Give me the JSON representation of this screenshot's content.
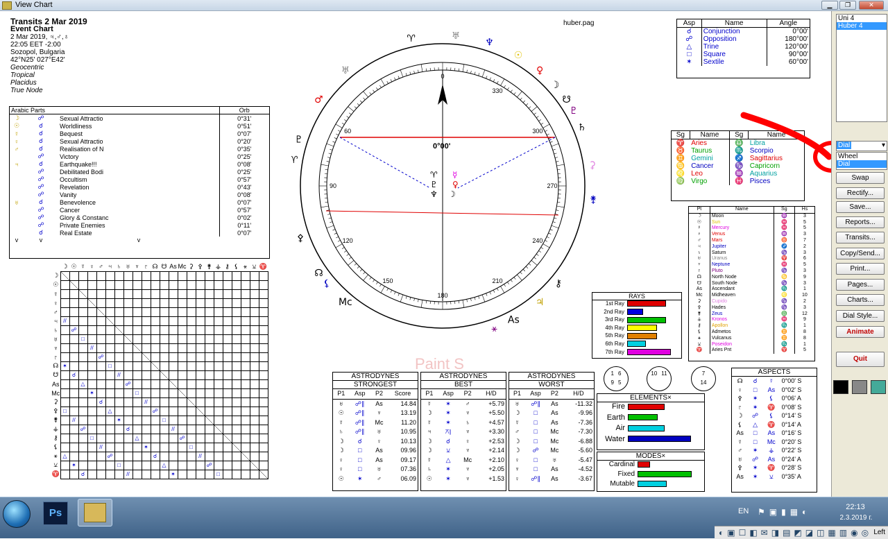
{
  "window": {
    "title": "View Chart"
  },
  "header": {
    "title": "Transits 2 Mar 2019",
    "subtitle": "Event Chart",
    "lines": [
      "2 Mar 2019, ♃,♂,♁",
      "22:05  EET -2:00",
      "Sozopol, Bulgaria",
      "42°N25' 027°E42'"
    ],
    "italic_lines": [
      "Geocentric",
      "Tropical",
      "Placidus",
      "True Node"
    ]
  },
  "filename": "huber.pag",
  "wheel": {
    "top_label": "0",
    "degree_labels": [
      "330",
      "300",
      "270",
      "240",
      "210",
      "180",
      "150",
      "120",
      "90",
      "60"
    ],
    "center_label": "0°00'"
  },
  "arabic_parts": {
    "headers": [
      "Arabic Parts",
      "Orb"
    ],
    "rows": [
      {
        "g1": "☽",
        "g2": "☍",
        "name": "Sexual Attractio",
        "orb": "0°31'"
      },
      {
        "g1": "☉",
        "g2": "☌",
        "name": "Worldliness",
        "orb": "0°51'"
      },
      {
        "g1": "☿",
        "g2": "☌",
        "name": "Bequest",
        "orb": "0°07'"
      },
      {
        "g1": "♀",
        "g2": "☌",
        "name": "Sexual Attractio",
        "orb": "0°20'"
      },
      {
        "g1": "♂",
        "g2": "☌",
        "name": "Realisation of N",
        "orb": "0°35'"
      },
      {
        "g1": "",
        "g2": "☍",
        "name": "Victory",
        "orb": "0°25'"
      },
      {
        "g1": "♃",
        "g2": "☌",
        "name": "Earthquake!!!",
        "orb": "0°08'"
      },
      {
        "g1": "",
        "g2": "☍",
        "name": "Debilitated Bodi",
        "orb": "0°25'"
      },
      {
        "g1": "",
        "g2": "☍",
        "name": "Occultism",
        "orb": "0°57'"
      },
      {
        "g1": "",
        "g2": "☍",
        "name": "Revelation",
        "orb": "0°43'"
      },
      {
        "g1": "",
        "g2": "☍",
        "name": "Vanity",
        "orb": "0°08'"
      },
      {
        "g1": "♅",
        "g2": "☌",
        "name": "Benevolence",
        "orb": "0°07'"
      },
      {
        "g1": "",
        "g2": "☍",
        "name": "Cancer",
        "orb": "0°57'"
      },
      {
        "g1": "",
        "g2": "☍",
        "name": "Glory & Constanc",
        "orb": "0°02'"
      },
      {
        "g1": "",
        "g2": "☍",
        "name": "Private Enemies",
        "orb": "0°11'"
      },
      {
        "g1": "",
        "g2": "☌",
        "name": "Real Estate",
        "orb": "0°07'"
      }
    ],
    "scroll": [
      "v",
      "v",
      "v"
    ]
  },
  "aspect_legend": {
    "headers": [
      "Asp",
      "Name",
      "Angle"
    ],
    "rows": [
      {
        "g": "☌",
        "name": "Conjunction",
        "angle": "0°00'"
      },
      {
        "g": "☍",
        "name": "Opposition",
        "angle": "180°00'"
      },
      {
        "g": "△",
        "name": "Trine",
        "angle": "120°00'"
      },
      {
        "g": "□",
        "name": "Square",
        "angle": "90°00'"
      },
      {
        "g": "✶",
        "name": "Sextile",
        "angle": "60°00'"
      }
    ]
  },
  "signs": {
    "headers": [
      "Sg",
      "Name",
      "Sg",
      "Name"
    ],
    "rows": [
      {
        "g1": "♈",
        "n1": "Aries",
        "c1": "#e00000",
        "g2": "♎",
        "n2": "Libra",
        "c2": "#00a0a0"
      },
      {
        "g1": "♉",
        "n1": "Taurus",
        "c1": "#00a000",
        "g2": "♏",
        "n2": "Scorpio",
        "c2": "#0000c0"
      },
      {
        "g1": "♊",
        "n1": "Gemini",
        "c1": "#00a0a0",
        "g2": "♐",
        "n2": "Sagittarius",
        "c2": "#e00000"
      },
      {
        "g1": "♋",
        "n1": "Cancer",
        "c1": "#0000c0",
        "g2": "♑",
        "n2": "Capricorn",
        "c2": "#00a000"
      },
      {
        "g1": "♌",
        "n1": "Leo",
        "c1": "#e00000",
        "g2": "♒",
        "n2": "Aquarius",
        "c2": "#00a0a0"
      },
      {
        "g1": "♍",
        "n1": "Virgo",
        "c1": "#00a000",
        "g2": "♓",
        "n2": "Pisces",
        "c2": "#0000c0"
      }
    ]
  },
  "planets": {
    "headers": [
      "Pt",
      "Name",
      "Sg",
      "Hs"
    ],
    "rows": [
      {
        "g": "☽",
        "name": "Moon",
        "sg": "♒",
        "hs": "3",
        "c": "#000"
      },
      {
        "g": "☉",
        "name": "Sun",
        "sg": "♓",
        "hs": "5",
        "c": "#e0c000"
      },
      {
        "g": "☿",
        "name": "Mercury",
        "sg": "♓",
        "hs": "5",
        "c": "#e000e0"
      },
      {
        "g": "♀",
        "name": "Venus",
        "sg": "♒",
        "hs": "3",
        "c": "#e00000"
      },
      {
        "g": "♂",
        "name": "Mars",
        "sg": "♉",
        "hs": "7",
        "c": "#e00000"
      },
      {
        "g": "♃",
        "name": "Jupiter",
        "sg": "♐",
        "hs": "2",
        "c": "#0000c0"
      },
      {
        "g": "♄",
        "name": "Saturn",
        "sg": "♑",
        "hs": "3",
        "c": "#000"
      },
      {
        "g": "♅",
        "name": "Uranus",
        "sg": "♈",
        "hs": "6",
        "c": "#808080"
      },
      {
        "g": "♆",
        "name": "Neptune",
        "sg": "♓",
        "hs": "5",
        "c": "#0000c0"
      },
      {
        "g": "♇",
        "name": "Pluto",
        "sg": "♑",
        "hs": "3",
        "c": "#800080"
      },
      {
        "g": "☊",
        "name": "North Node",
        "sg": "♋",
        "hs": "9",
        "c": "#000"
      },
      {
        "g": "☋",
        "name": "South Node",
        "sg": "♑",
        "hs": "3",
        "c": "#000"
      },
      {
        "g": "As",
        "name": "Ascendant",
        "sg": "♏",
        "hs": "1",
        "c": "#000"
      },
      {
        "g": "Mc",
        "name": "Midheaven",
        "sg": "♌",
        "hs": "10",
        "c": "#000"
      },
      {
        "g": "⚳",
        "name": "Cupido",
        "sg": "♑",
        "hs": "2",
        "c": "#e080e0"
      },
      {
        "g": "⚴",
        "name": "Hades",
        "sg": "♑",
        "hs": "3",
        "c": "#000"
      },
      {
        "g": "⚵",
        "name": "Zeus",
        "sg": "♎",
        "hs": "12",
        "c": "#0000c0"
      },
      {
        "g": "⚶",
        "name": "Kronos",
        "sg": "♓",
        "hs": "9",
        "c": "#e000e0"
      },
      {
        "g": "⚷",
        "name": "Apollon",
        "sg": "♏",
        "hs": "1",
        "c": "#e0a000"
      },
      {
        "g": "⚸",
        "name": "Admetos",
        "sg": "♊",
        "hs": "8",
        "c": "#000"
      },
      {
        "g": "⚹",
        "name": "Vulcanus",
        "sg": "♊",
        "hs": "8",
        "c": "#000"
      },
      {
        "g": "⚺",
        "name": "Poseidon",
        "sg": "♏",
        "hs": "1",
        "c": "#e000e0"
      },
      {
        "g": "♈",
        "name": "Aries Pnt",
        "sg": "♈",
        "hs": "5",
        "c": "#000"
      }
    ]
  },
  "rays": {
    "title": "RAYS",
    "rows": [
      {
        "label": "1st Ray",
        "value": 0.78,
        "color": "#e00000"
      },
      {
        "label": "2nd Ray",
        "value": 0.32,
        "color": "#0000e0"
      },
      {
        "label": "3rd Ray",
        "value": 0.78,
        "color": "#00c000"
      },
      {
        "label": "4th Ray",
        "value": 0.6,
        "color": "#ffff00"
      },
      {
        "label": "5th Ray",
        "value": 0.6,
        "color": "#e08000"
      },
      {
        "label": "6th Ray",
        "value": 0.38,
        "color": "#00d0e0"
      },
      {
        "label": "7th Ray",
        "value": 0.88,
        "color": "#e000e0"
      }
    ]
  },
  "astrodynes": [
    {
      "t1": "ASTRODYNES",
      "t2": "STRONGEST",
      "cols": [
        "P1",
        "Asp",
        "P2",
        "Score"
      ],
      "rows": [
        [
          "♅",
          "☍∥",
          "As",
          "14.84"
        ],
        [
          "☉",
          "☍∥",
          "♆",
          "13.19"
        ],
        [
          "☿",
          "☍∥",
          "Mc",
          "11.20"
        ],
        [
          "♄",
          "☍∥",
          "♅",
          "10.95"
        ],
        [
          "☽",
          "☌",
          "♀",
          "10.13"
        ],
        [
          "☽",
          "□",
          "As",
          "09.96"
        ],
        [
          "♀",
          "□",
          "As",
          "09.17"
        ],
        [
          "♀",
          "□",
          "♅",
          "07.36"
        ],
        [
          "☉",
          "✶",
          "♂",
          "06.09"
        ]
      ]
    },
    {
      "t1": "ASTRODYNES",
      "t2": "BEST",
      "cols": [
        "P1",
        "Asp",
        "P2",
        "H/D"
      ],
      "rows": [
        [
          "☿",
          "✶",
          "♂",
          "+5.79"
        ],
        [
          "☽",
          "✶",
          "♆",
          "+5.50"
        ],
        [
          "☿",
          "✶",
          "♄",
          "+4.57"
        ],
        [
          "♃",
          "⚻∥",
          "♆",
          "+3.30"
        ],
        [
          "☽",
          "☌",
          "♀",
          "+2.53"
        ],
        [
          "☽",
          "⚺",
          "♆",
          "+2.14"
        ],
        [
          "☿",
          "△",
          "Mc",
          "+2.10"
        ],
        [
          "♄",
          "✶",
          "♆",
          "+2.05"
        ],
        [
          "☉",
          "✶",
          "♆",
          "+1.53"
        ]
      ]
    },
    {
      "t1": "ASTRODYNES",
      "t2": "WORST",
      "cols": [
        "P1",
        "Asp",
        "P2",
        "H/D"
      ],
      "rows": [
        [
          "♅",
          "☍∥",
          "As",
          "-11.32"
        ],
        [
          "☽",
          "□",
          "As",
          "-9.96"
        ],
        [
          "☿",
          "□",
          "As",
          "-7.36"
        ],
        [
          "♂",
          "□",
          "Mc",
          "-7.30"
        ],
        [
          "☽",
          "□",
          "Mc",
          "-6.88"
        ],
        [
          "☽",
          "☍",
          "Mc",
          "-5.60"
        ],
        [
          "♀",
          "□",
          "♅",
          "-5.47"
        ],
        [
          "♆",
          "□",
          "As",
          "-4.52"
        ],
        [
          "♀",
          "☍∥",
          "As",
          "-3.67"
        ]
      ]
    }
  ],
  "circles": [
    {
      "top": [
        "1",
        "6"
      ],
      "bottom": [
        "9",
        "5"
      ]
    },
    {
      "top": [],
      "bottom": [
        "10",
        "11"
      ]
    },
    {
      "top": [
        "7"
      ],
      "bottom": [
        "14"
      ]
    }
  ],
  "elements": {
    "title": "ELEMENTS×",
    "rows": [
      {
        "label": "Fire",
        "value": 0.55,
        "color": "#e00000"
      },
      {
        "label": "Earth",
        "value": 0.45,
        "color": "#00c000"
      },
      {
        "label": "Air",
        "value": 0.55,
        "color": "#00d0e0"
      },
      {
        "label": "Water",
        "value": 0.95,
        "color": "#0000c0"
      }
    ]
  },
  "modes": {
    "title": "MODES×",
    "rows": [
      {
        "label": "Cardinal",
        "value": 0.22,
        "color": "#e00000"
      },
      {
        "label": "Fixed",
        "value": 0.98,
        "color": "#00c000"
      },
      {
        "label": "Mutable",
        "value": 0.52,
        "color": "#00d0e0"
      }
    ]
  },
  "aspects": {
    "title": "ASPECTS",
    "rows": [
      {
        "p1": "☊",
        "a": "☌",
        "p2": "☿",
        "orb": "0°00' S"
      },
      {
        "p1": "♀",
        "a": "□",
        "p2": "As",
        "orb": "0°02' S"
      },
      {
        "p1": "⚴",
        "a": "✶",
        "p2": "⚸",
        "orb": "0°06' A"
      },
      {
        "p1": "♇",
        "a": "✶",
        "p2": "♈",
        "orb": "0°08' S"
      },
      {
        "p1": "☽",
        "a": "☍",
        "p2": "⚸",
        "orb": "0°14' S"
      },
      {
        "p1": "⚸",
        "a": "△",
        "p2": "♈",
        "orb": "0°14' A"
      },
      {
        "p1": "As",
        "a": "□",
        "p2": "As",
        "orb": "0°16' S"
      },
      {
        "p1": "☿",
        "a": "□",
        "p2": "Mc",
        "orb": "0°20' S"
      },
      {
        "p1": "♂",
        "a": "✶",
        "p2": "⚶",
        "orb": "0°22' S"
      },
      {
        "p1": "♅",
        "a": "☍",
        "p2": "As",
        "orb": "0°24' A"
      },
      {
        "p1": "⚴",
        "a": "✶",
        "p2": "♈",
        "orb": "0°28' S"
      },
      {
        "p1": "As",
        "a": "✶",
        "p2": "⚺",
        "orb": "0°35' A"
      }
    ]
  },
  "matrix": {
    "header_glyphs": [
      "☽",
      "☉",
      "☿",
      "♀",
      "♂",
      "♃",
      "♄",
      "♅",
      "♆",
      "♇",
      "☊",
      "☋",
      "As",
      "Mc",
      "⚳",
      "⚴",
      "⚵",
      "⚶",
      "⚷",
      "⚸",
      "⚹",
      "⚺",
      "♈"
    ],
    "row_glyphs": [
      "☽",
      "☉",
      "☿",
      "♀",
      "♂",
      "♃",
      "♄",
      "♅",
      "♆",
      "♇",
      "☊",
      "☋",
      "As",
      "Mc",
      "⚳",
      "⚴",
      "⚵",
      "⚶",
      "⚷",
      "⚸",
      "⚹",
      "⚺",
      "♈"
    ]
  },
  "right_panel": {
    "list_items": [
      "Uni 4",
      "Huber 4"
    ],
    "selected_list_item": "Huber 4",
    "dropdown_value": "Dial",
    "dropdown_options": [
      "Wheel",
      "Dial"
    ],
    "buttons": [
      "Swap",
      "Rectify...",
      "Save...",
      "Reports...",
      "Transits...",
      "Copy/Send...",
      "Print...",
      "Pages...",
      "Charts...",
      "Dial Style...",
      "Animate",
      "Quit"
    ]
  },
  "watermark": "Paint S",
  "taskbar": {
    "lang": "EN",
    "time": "22:13",
    "date": "2.3.2019 г.",
    "quicklaunch_tail": "Left"
  },
  "colors": {
    "selection": "#3399ff",
    "red_annotation": "#ff0000"
  }
}
